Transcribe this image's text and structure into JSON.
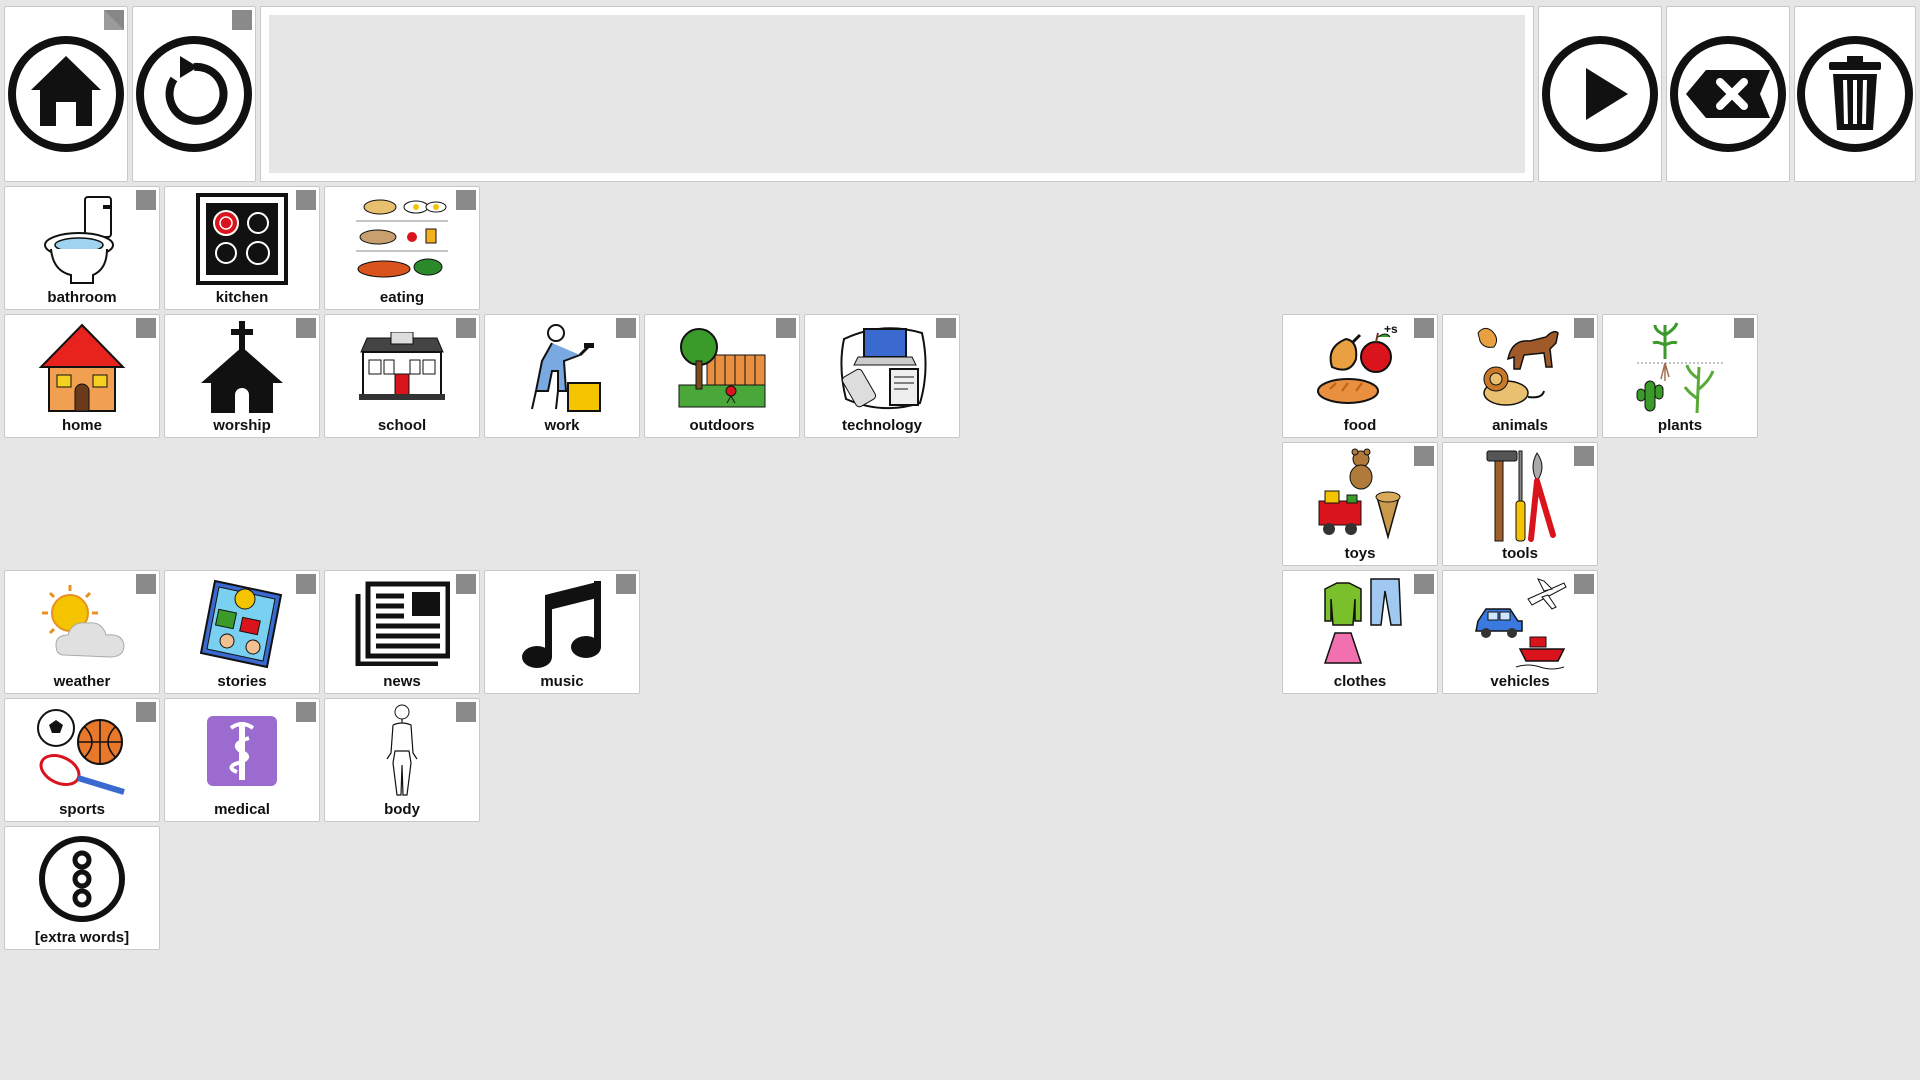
{
  "app": {
    "background": "#e6e6e6",
    "tile_background": "#ffffff",
    "tile_border": "#c8c8c8"
  },
  "toolbar": {
    "home_icon": "home-icon",
    "back_icon": "back-arrow-icon",
    "message_text": "",
    "speak_icon": "play-icon",
    "backspace_icon": "backspace-icon",
    "clear_icon": "trash-icon"
  },
  "tiles": {
    "bathroom": "bathroom",
    "kitchen": "kitchen",
    "eating": "eating",
    "home": "home",
    "worship": "worship",
    "school": "school",
    "work": "work",
    "outdoors": "outdoors",
    "technology": "technology",
    "food": "food",
    "animals": "animals",
    "plants": "plants",
    "toys": "toys",
    "tools": "tools",
    "clothes": "clothes",
    "vehicles": "vehicles",
    "weather": "weather",
    "stories": "stories",
    "news": "news",
    "music": "music",
    "sports": "sports",
    "medical": "medical",
    "body": "body",
    "extra_words": "[extra words]"
  },
  "tile_icons": {
    "folder_marker": "folder-corner-icon",
    "food_superscript": "+s"
  },
  "colors": {
    "icon_black": "#111111",
    "medical_purple": "#9b6bd0",
    "house_red": "#e8231e",
    "folder_marker_gray": "#7a7a7a"
  }
}
